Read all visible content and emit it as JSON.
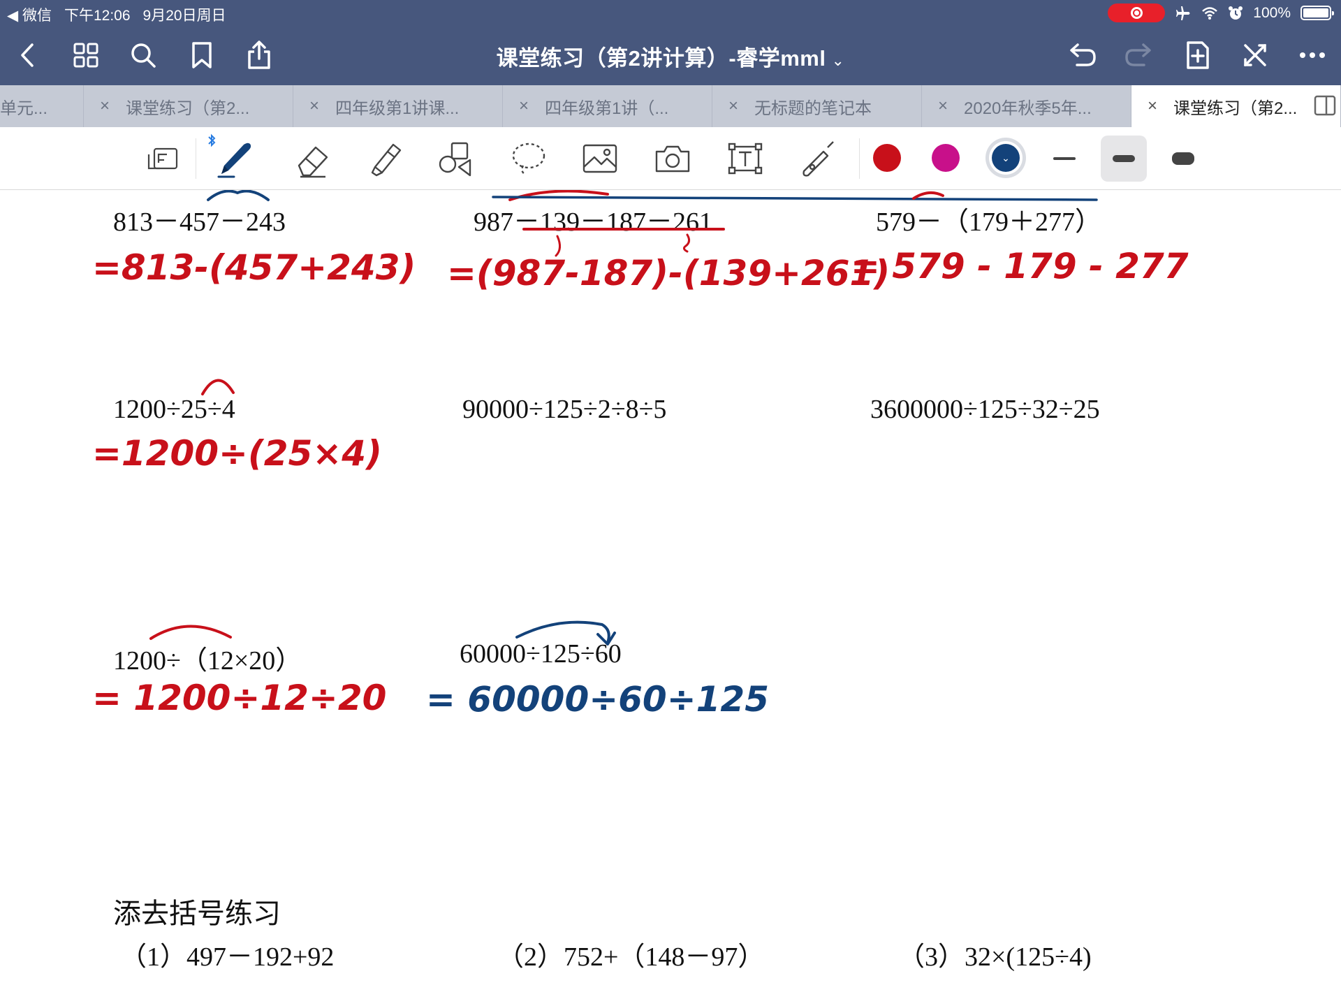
{
  "status_bar": {
    "back_app": "◀ 微信",
    "time": "下午12:06",
    "date": "9月20日周日",
    "battery": "100%"
  },
  "nav": {
    "title": "课堂练习（第2讲计算）-睿学mml",
    "title_chevron": "⌄"
  },
  "tabs": [
    {
      "label": "单元..."
    },
    {
      "label": "课堂练习（第2..."
    },
    {
      "label": "四年级第1讲课..."
    },
    {
      "label": "四年级第1讲（..."
    },
    {
      "label": "无标题的笔记本"
    },
    {
      "label": "2020年秋季5年..."
    },
    {
      "label": "课堂练习（第2...",
      "active": true
    }
  ],
  "tab_close_glyph": "×",
  "toolbar": {
    "tools": [
      "page-view-icon",
      "pen-icon",
      "eraser-icon",
      "highlighter-icon",
      "shapes-icon",
      "lasso-icon",
      "image-icon",
      "camera-icon",
      "text-box-icon",
      "laser-pointer-icon"
    ],
    "colors": [
      "#c8101a",
      "#c8108a",
      "#13427a"
    ],
    "selected_color": "#13427a",
    "stroke_widths": [
      "thin",
      "medium",
      "thick"
    ],
    "selected_stroke": "medium"
  },
  "problems": [
    {
      "text": "813－457－243",
      "answer": "=813-(457+243)"
    },
    {
      "text": "987－139－187－261",
      "answer": "=(987-187)-(139+261)"
    },
    {
      "text": "579－（179＋277）",
      "answer": "= 579 - 179 - 277"
    },
    {
      "text": "1200÷25÷4",
      "answer": "=1200÷(25×4)"
    },
    {
      "text": "90000÷125÷2÷8÷5"
    },
    {
      "text": "3600000÷125÷32÷25"
    },
    {
      "text": "1200÷（12×20）",
      "answer": "= 1200÷12÷20"
    },
    {
      "text": "60000÷125÷60",
      "answer": "= 60000÷60÷125"
    }
  ],
  "section": {
    "title": "添去括号练习",
    "items": [
      "（1）497－192+92",
      "（2）752+（148－97）",
      "（3）32×(125÷4)"
    ]
  },
  "ink_colors": {
    "red": "#c8101a",
    "blue": "#13427a"
  }
}
